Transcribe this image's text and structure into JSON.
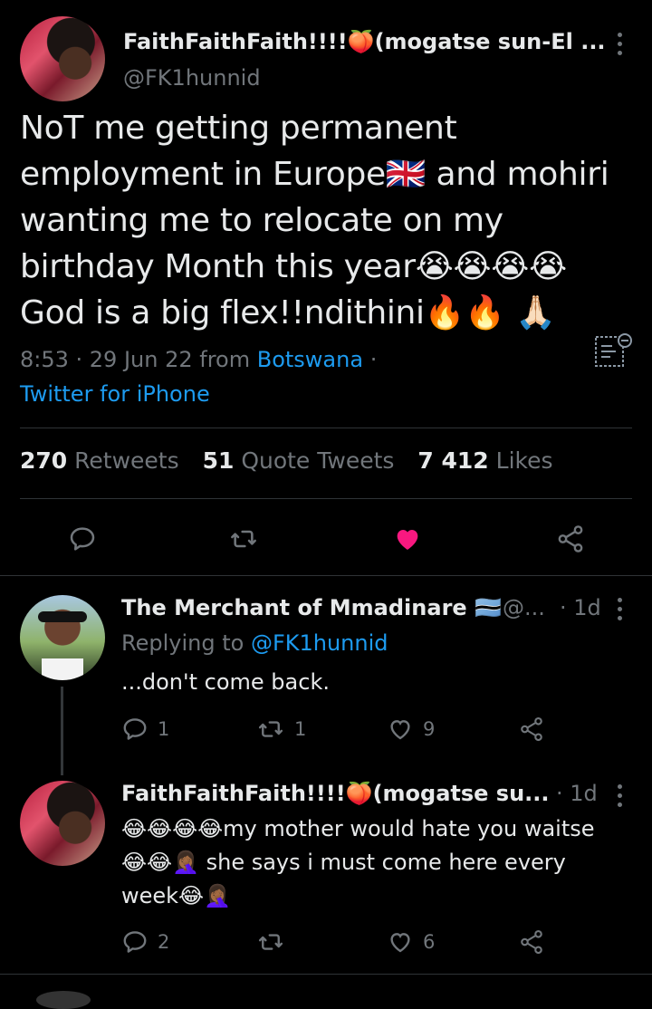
{
  "main_tweet": {
    "author_name": "FaithFaithFaith!!!!🍑(mogatse sun-El ...",
    "author_handle": "@FK1hunnid",
    "text_lines": [
      "NoT me getting permanent",
      "employment in Europe🇬🇧 and mohiri",
      "wanting me to relocate on my",
      "birthday Month this year😭😭😭😭",
      "God is a big flex!!ndithini🔥🔥 🙏🏻"
    ],
    "time": "8:53 · 29 Jun 22 from ",
    "location": "Botswana",
    "location_sep": " ·",
    "source": "Twitter for iPhone",
    "stats": {
      "retweets": "270",
      "retweets_label": "Retweets",
      "quotes": "51",
      "quotes_label": "Quote Tweets",
      "likes": "7 412",
      "likes_label": "Likes"
    }
  },
  "replies": [
    {
      "name": "The Merchant of Mmadinare 🇧🇼",
      "handle": "@...",
      "time": "· 1d",
      "replying_prefix": "Replying to ",
      "replying_handle": "@FK1hunnid",
      "text": "...don't come back.",
      "reply_count": "1",
      "retweet_count": "1",
      "like_count": "9"
    },
    {
      "name": "FaithFaithFaith!!!!🍑(mogatse su...",
      "time": "· 1d",
      "text_lines": [
        "😂😂😂😂my mother would hate you waitse",
        "😂😂🤦🏾‍♀️ she says i must come here every",
        "week😂🤦🏾‍♀️"
      ],
      "reply_count": "2",
      "retweet_count": "",
      "like_count": "6"
    }
  ],
  "colors": {
    "accent": "#1d9bf0",
    "like": "#f91880",
    "muted": "#71767b",
    "bg": "#000000"
  },
  "icons": [
    "reply-icon",
    "retweet-icon",
    "heart-icon",
    "share-icon",
    "more-icon",
    "translate-icon"
  ]
}
